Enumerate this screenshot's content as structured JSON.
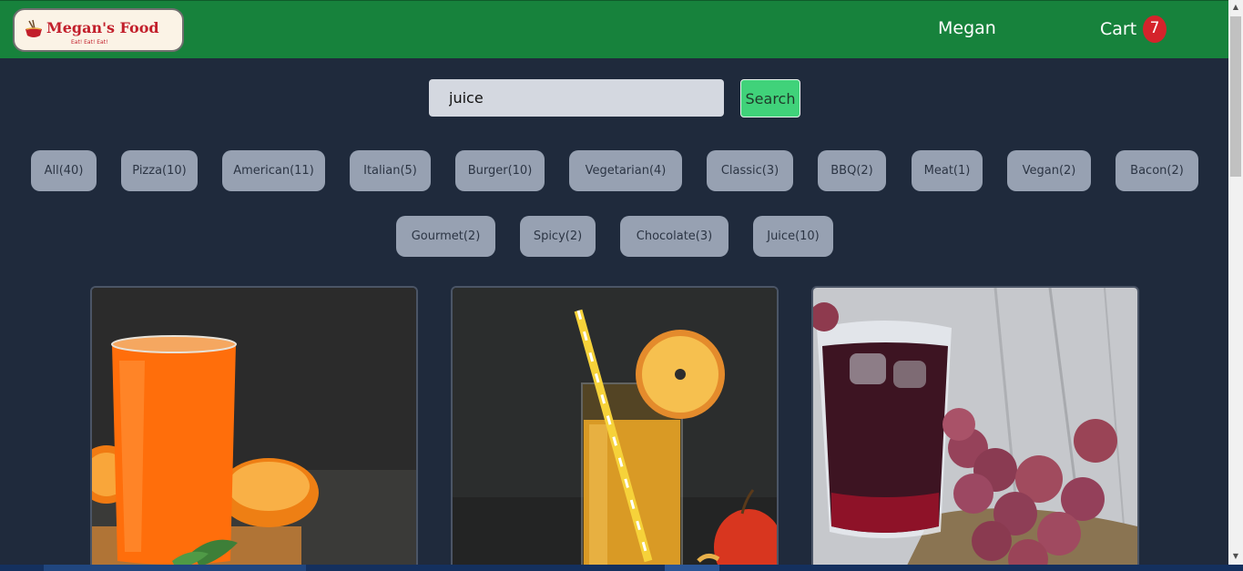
{
  "header": {
    "logo": {
      "name": "Megan's Food",
      "tagline": "Eat! Eat! Eat!"
    },
    "username": "Megan",
    "cart": {
      "label": "Cart",
      "count": "7"
    }
  },
  "search": {
    "value": "juice",
    "button_label": "Search"
  },
  "tags": [
    "All(40)",
    "Pizza(10)",
    "American(11)",
    "Italian(5)",
    "Burger(10)",
    "Vegetarian(4)",
    "Classic(3)",
    "BBQ(2)",
    "Meat(1)",
    "Vegan(2)",
    "Bacon(2)",
    "Gourmet(2)",
    "Spicy(2)",
    "Chocolate(3)",
    "Juice(10)"
  ],
  "foods": [
    {
      "image": "orange-juice-glass"
    },
    {
      "image": "apple-juice-glass"
    },
    {
      "image": "grape-juice-glass"
    }
  ],
  "colors": {
    "header": "#17823c",
    "background": "#1f2a3c",
    "tag": "#97a1b2",
    "search_button": "#40d27a",
    "badge": "#d5232b"
  }
}
